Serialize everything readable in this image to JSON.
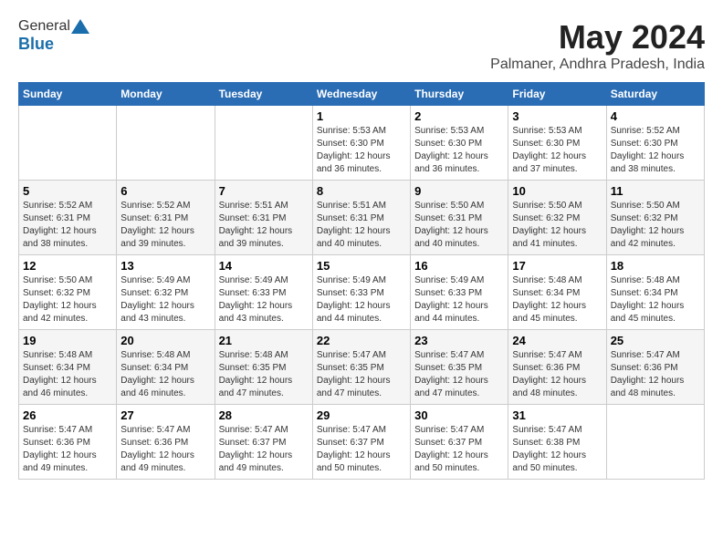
{
  "logo": {
    "general": "General",
    "blue": "Blue"
  },
  "title": {
    "month_year": "May 2024",
    "location": "Palmaner, Andhra Pradesh, India"
  },
  "weekdays": [
    "Sunday",
    "Monday",
    "Tuesday",
    "Wednesday",
    "Thursday",
    "Friday",
    "Saturday"
  ],
  "weeks": [
    [
      {
        "day": "",
        "sunrise": "",
        "sunset": "",
        "daylight": ""
      },
      {
        "day": "",
        "sunrise": "",
        "sunset": "",
        "daylight": ""
      },
      {
        "day": "",
        "sunrise": "",
        "sunset": "",
        "daylight": ""
      },
      {
        "day": "1",
        "sunrise": "Sunrise: 5:53 AM",
        "sunset": "Sunset: 6:30 PM",
        "daylight": "Daylight: 12 hours and 36 minutes."
      },
      {
        "day": "2",
        "sunrise": "Sunrise: 5:53 AM",
        "sunset": "Sunset: 6:30 PM",
        "daylight": "Daylight: 12 hours and 36 minutes."
      },
      {
        "day": "3",
        "sunrise": "Sunrise: 5:53 AM",
        "sunset": "Sunset: 6:30 PM",
        "daylight": "Daylight: 12 hours and 37 minutes."
      },
      {
        "day": "4",
        "sunrise": "Sunrise: 5:52 AM",
        "sunset": "Sunset: 6:30 PM",
        "daylight": "Daylight: 12 hours and 38 minutes."
      }
    ],
    [
      {
        "day": "5",
        "sunrise": "Sunrise: 5:52 AM",
        "sunset": "Sunset: 6:31 PM",
        "daylight": "Daylight: 12 hours and 38 minutes."
      },
      {
        "day": "6",
        "sunrise": "Sunrise: 5:52 AM",
        "sunset": "Sunset: 6:31 PM",
        "daylight": "Daylight: 12 hours and 39 minutes."
      },
      {
        "day": "7",
        "sunrise": "Sunrise: 5:51 AM",
        "sunset": "Sunset: 6:31 PM",
        "daylight": "Daylight: 12 hours and 39 minutes."
      },
      {
        "day": "8",
        "sunrise": "Sunrise: 5:51 AM",
        "sunset": "Sunset: 6:31 PM",
        "daylight": "Daylight: 12 hours and 40 minutes."
      },
      {
        "day": "9",
        "sunrise": "Sunrise: 5:50 AM",
        "sunset": "Sunset: 6:31 PM",
        "daylight": "Daylight: 12 hours and 40 minutes."
      },
      {
        "day": "10",
        "sunrise": "Sunrise: 5:50 AM",
        "sunset": "Sunset: 6:32 PM",
        "daylight": "Daylight: 12 hours and 41 minutes."
      },
      {
        "day": "11",
        "sunrise": "Sunrise: 5:50 AM",
        "sunset": "Sunset: 6:32 PM",
        "daylight": "Daylight: 12 hours and 42 minutes."
      }
    ],
    [
      {
        "day": "12",
        "sunrise": "Sunrise: 5:50 AM",
        "sunset": "Sunset: 6:32 PM",
        "daylight": "Daylight: 12 hours and 42 minutes."
      },
      {
        "day": "13",
        "sunrise": "Sunrise: 5:49 AM",
        "sunset": "Sunset: 6:32 PM",
        "daylight": "Daylight: 12 hours and 43 minutes."
      },
      {
        "day": "14",
        "sunrise": "Sunrise: 5:49 AM",
        "sunset": "Sunset: 6:33 PM",
        "daylight": "Daylight: 12 hours and 43 minutes."
      },
      {
        "day": "15",
        "sunrise": "Sunrise: 5:49 AM",
        "sunset": "Sunset: 6:33 PM",
        "daylight": "Daylight: 12 hours and 44 minutes."
      },
      {
        "day": "16",
        "sunrise": "Sunrise: 5:49 AM",
        "sunset": "Sunset: 6:33 PM",
        "daylight": "Daylight: 12 hours and 44 minutes."
      },
      {
        "day": "17",
        "sunrise": "Sunrise: 5:48 AM",
        "sunset": "Sunset: 6:34 PM",
        "daylight": "Daylight: 12 hours and 45 minutes."
      },
      {
        "day": "18",
        "sunrise": "Sunrise: 5:48 AM",
        "sunset": "Sunset: 6:34 PM",
        "daylight": "Daylight: 12 hours and 45 minutes."
      }
    ],
    [
      {
        "day": "19",
        "sunrise": "Sunrise: 5:48 AM",
        "sunset": "Sunset: 6:34 PM",
        "daylight": "Daylight: 12 hours and 46 minutes."
      },
      {
        "day": "20",
        "sunrise": "Sunrise: 5:48 AM",
        "sunset": "Sunset: 6:34 PM",
        "daylight": "Daylight: 12 hours and 46 minutes."
      },
      {
        "day": "21",
        "sunrise": "Sunrise: 5:48 AM",
        "sunset": "Sunset: 6:35 PM",
        "daylight": "Daylight: 12 hours and 47 minutes."
      },
      {
        "day": "22",
        "sunrise": "Sunrise: 5:47 AM",
        "sunset": "Sunset: 6:35 PM",
        "daylight": "Daylight: 12 hours and 47 minutes."
      },
      {
        "day": "23",
        "sunrise": "Sunrise: 5:47 AM",
        "sunset": "Sunset: 6:35 PM",
        "daylight": "Daylight: 12 hours and 47 minutes."
      },
      {
        "day": "24",
        "sunrise": "Sunrise: 5:47 AM",
        "sunset": "Sunset: 6:36 PM",
        "daylight": "Daylight: 12 hours and 48 minutes."
      },
      {
        "day": "25",
        "sunrise": "Sunrise: 5:47 AM",
        "sunset": "Sunset: 6:36 PM",
        "daylight": "Daylight: 12 hours and 48 minutes."
      }
    ],
    [
      {
        "day": "26",
        "sunrise": "Sunrise: 5:47 AM",
        "sunset": "Sunset: 6:36 PM",
        "daylight": "Daylight: 12 hours and 49 minutes."
      },
      {
        "day": "27",
        "sunrise": "Sunrise: 5:47 AM",
        "sunset": "Sunset: 6:36 PM",
        "daylight": "Daylight: 12 hours and 49 minutes."
      },
      {
        "day": "28",
        "sunrise": "Sunrise: 5:47 AM",
        "sunset": "Sunset: 6:37 PM",
        "daylight": "Daylight: 12 hours and 49 minutes."
      },
      {
        "day": "29",
        "sunrise": "Sunrise: 5:47 AM",
        "sunset": "Sunset: 6:37 PM",
        "daylight": "Daylight: 12 hours and 50 minutes."
      },
      {
        "day": "30",
        "sunrise": "Sunrise: 5:47 AM",
        "sunset": "Sunset: 6:37 PM",
        "daylight": "Daylight: 12 hours and 50 minutes."
      },
      {
        "day": "31",
        "sunrise": "Sunrise: 5:47 AM",
        "sunset": "Sunset: 6:38 PM",
        "daylight": "Daylight: 12 hours and 50 minutes."
      },
      {
        "day": "",
        "sunrise": "",
        "sunset": "",
        "daylight": ""
      }
    ]
  ]
}
